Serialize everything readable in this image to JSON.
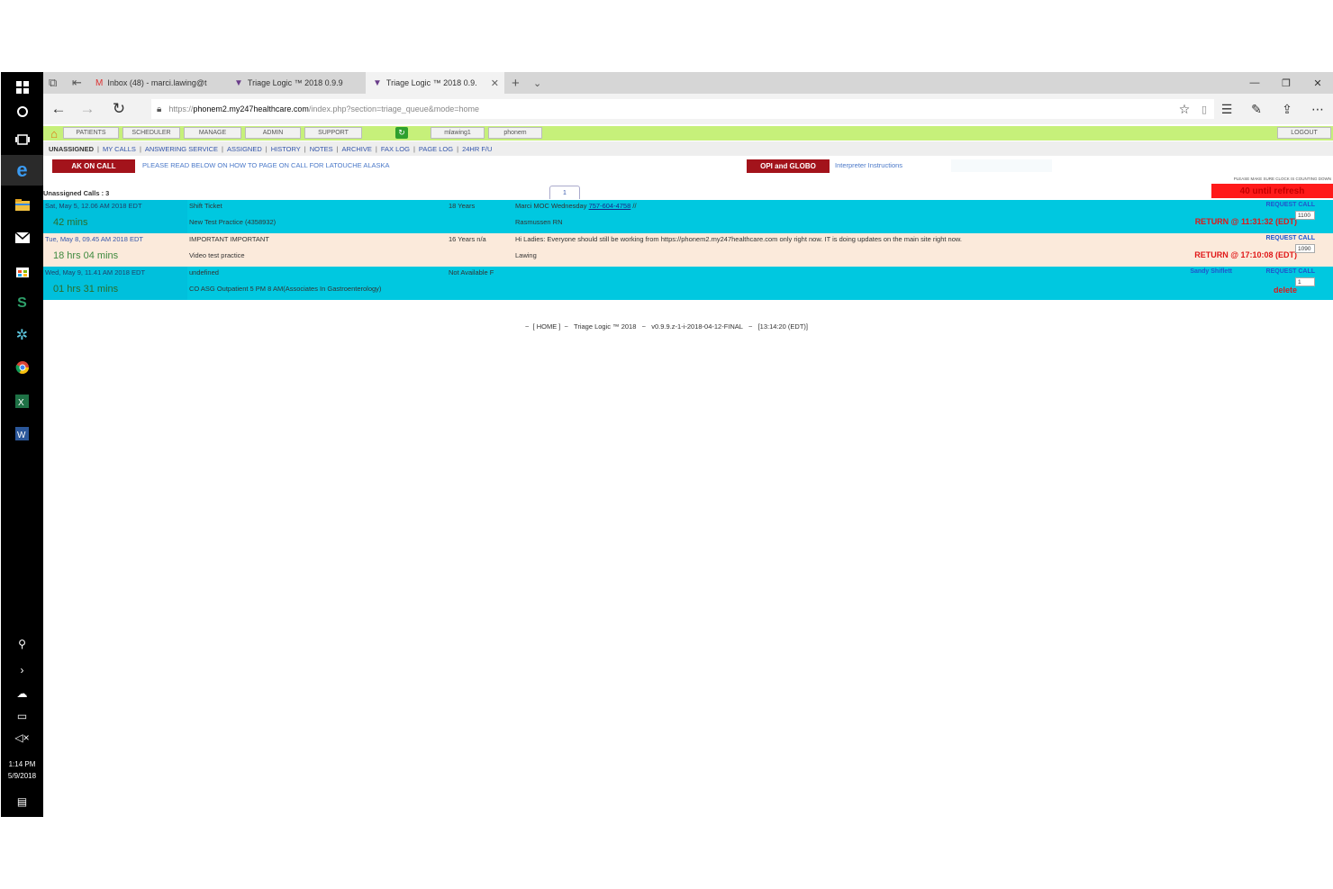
{
  "taskbar": {
    "time": "1:14 PM",
    "date": "5/9/2018"
  },
  "browser": {
    "tabs": [
      {
        "label": "Inbox (48) - marci.lawing@t",
        "icon": "gmail-icon"
      },
      {
        "label": "Triage Logic ™ 2018 0.9.9",
        "icon": "triage-logo-icon"
      },
      {
        "label": "Triage Logic ™ 2018 0.9.",
        "icon": "triage-logo-icon"
      }
    ],
    "url_prefix": "https://",
    "url_domain": "phonem2.my247healthcare.com",
    "url_path": "/index.php?section=triage_queue&mode=home"
  },
  "menu": {
    "items": [
      "PATIENTS",
      "SCHEDULER",
      "MANAGE",
      "ADMIN",
      "SUPPORT"
    ],
    "user": "mlawing1",
    "server": "phonem",
    "logout": "LOGOUT"
  },
  "subnav": {
    "items": [
      "UNASSIGNED",
      "MY CALLS",
      "ANSWERING SERVICE",
      "ASSIGNED",
      "HISTORY",
      "NOTES",
      "ARCHIVE",
      "FAX LOG",
      "PAGE LOG",
      "24HR F/U"
    ]
  },
  "banner": {
    "ak_on_call": "AK ON CALL",
    "ak_note": "PLEASE READ BELOW ON HOW TO PAGE ON CALL FOR LATOUCHE ALASKA",
    "opi": "OPI and GLOBO",
    "interpreter": "Interpreter Instructions"
  },
  "queue": {
    "unassigned_label": "Unassigned Calls : 3",
    "page": "1",
    "tiny_note": "PLEASE MAKE SURE CLOCK IS COUNTING DOWN",
    "refresh": "40 until refresh",
    "rows": [
      {
        "datetime": "Sat, May 5, 12.06 AM 2018 EDT",
        "elapsed": "42 mins",
        "subject": "Shift Ticket",
        "practice": "New Test Practice (4358932)",
        "age": "18 Years",
        "note": "Marci MOC Wednesday ",
        "phone": "757-604-4758",
        "note_tail": " //",
        "staff": "Rasmussen RN",
        "request": "REQUEST CALL",
        "status": "RETURN @ 11:31:32 (EDT)",
        "number": "1100",
        "style": "cyan"
      },
      {
        "datetime": "Tue, May 8, 09.45 AM 2018 EDT",
        "elapsed": "18 hrs 04 mins",
        "subject": "IMPORTANT IMPORTANT",
        "practice": "Video test practice",
        "age": "16 Years n/a",
        "note": "Hi Ladies: Everyone should still be working from https://phonem2.my247healthcare.com only right now. IT is doing updates on the main site right now.",
        "phone": "",
        "note_tail": "",
        "staff": "Lawing",
        "request": "REQUEST CALL",
        "status": "RETURN @ 17:10:08 (EDT)",
        "number": "1090",
        "style": "peach"
      },
      {
        "datetime": "Wed, May 9, 11.41 AM 2018 EDT",
        "elapsed": "01 hrs 31 mins",
        "subject": "undefined",
        "practice": "CO ASG Outpatient 5 PM 8 AM(Associates In Gastroenterology)",
        "age": "Not Available F",
        "note": "",
        "phone": "",
        "note_tail": "",
        "staff": "",
        "assignee": "Sandy Shiflett",
        "request": "REQUEST CALL",
        "status": "delete",
        "number": "1",
        "style": "cyan"
      }
    ]
  },
  "footer": {
    "text": "~  [ HOME ]  ~   Triage Logic ™ 2018   ~   v0.9.9.z-1-i-2018-04-12-FINAL   ~   [13:14:20 (EDT)]"
  }
}
